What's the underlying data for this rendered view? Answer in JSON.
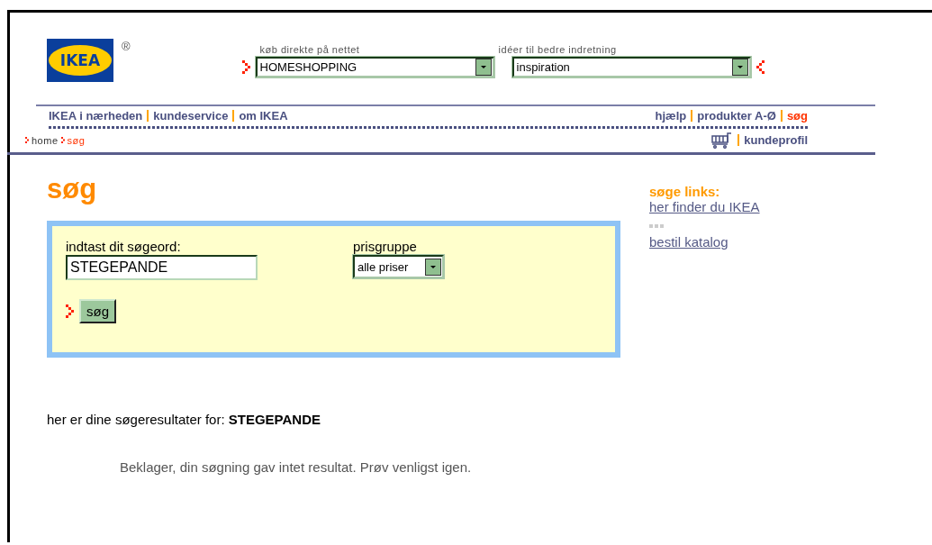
{
  "logo": {
    "text": "IKEA",
    "mark": "®"
  },
  "shop_selects": [
    {
      "label": "køb direkte på nettet",
      "value": "HOMESHOPPING",
      "kind": "arrow_before"
    },
    {
      "label": "idéer til bedre indretning",
      "value": "inspiration",
      "kind": "arrow_after"
    }
  ],
  "nav_left": [
    {
      "label": "IKEA i nærheden",
      "selected": false
    },
    {
      "label": "kundeservice",
      "selected": false
    },
    {
      "label": "om IKEA",
      "selected": false
    }
  ],
  "nav_right": [
    {
      "label": "hjælp",
      "selected": false
    },
    {
      "label": "produkter A-Ø",
      "selected": false
    },
    {
      "label": "søg",
      "selected": true
    }
  ],
  "breadcrumb": [
    {
      "label": "home",
      "selected": false
    },
    {
      "label": "søg",
      "selected": true
    }
  ],
  "profile_link": "kundeprofil",
  "page_title": "søg",
  "search_form": {
    "term_label": "indtast dit søgeord:",
    "term_value": "STEGEPANDE",
    "price_label": "prisgruppe",
    "price_value": "alle priser",
    "button": "søg"
  },
  "sidebar": {
    "title": "søge links:",
    "links": [
      "her finder du IKEA",
      "bestil katalog"
    ]
  },
  "results": {
    "intro": "her er dine søgeresultater for: **STEGEPANDE**",
    "message": "Beklager, din søgning gav intet resultat. Prøv venligst igen."
  }
}
